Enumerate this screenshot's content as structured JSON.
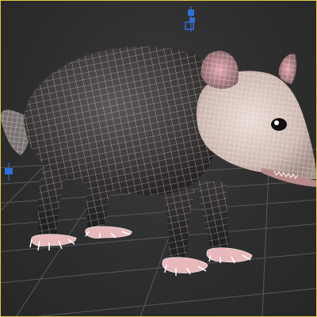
{
  "viewport": {
    "model_name": "",
    "colors": {
      "background": "#2e2e2e",
      "grid": "#5a5a5a",
      "wireframe": "#f2f2f2",
      "active_border": "#e3c84a",
      "gizmo": "#2f6fd6"
    }
  },
  "icons": {
    "light_gizmo": "light-gizmo-icon",
    "pivot_marker": "pivot-marker-icon"
  }
}
